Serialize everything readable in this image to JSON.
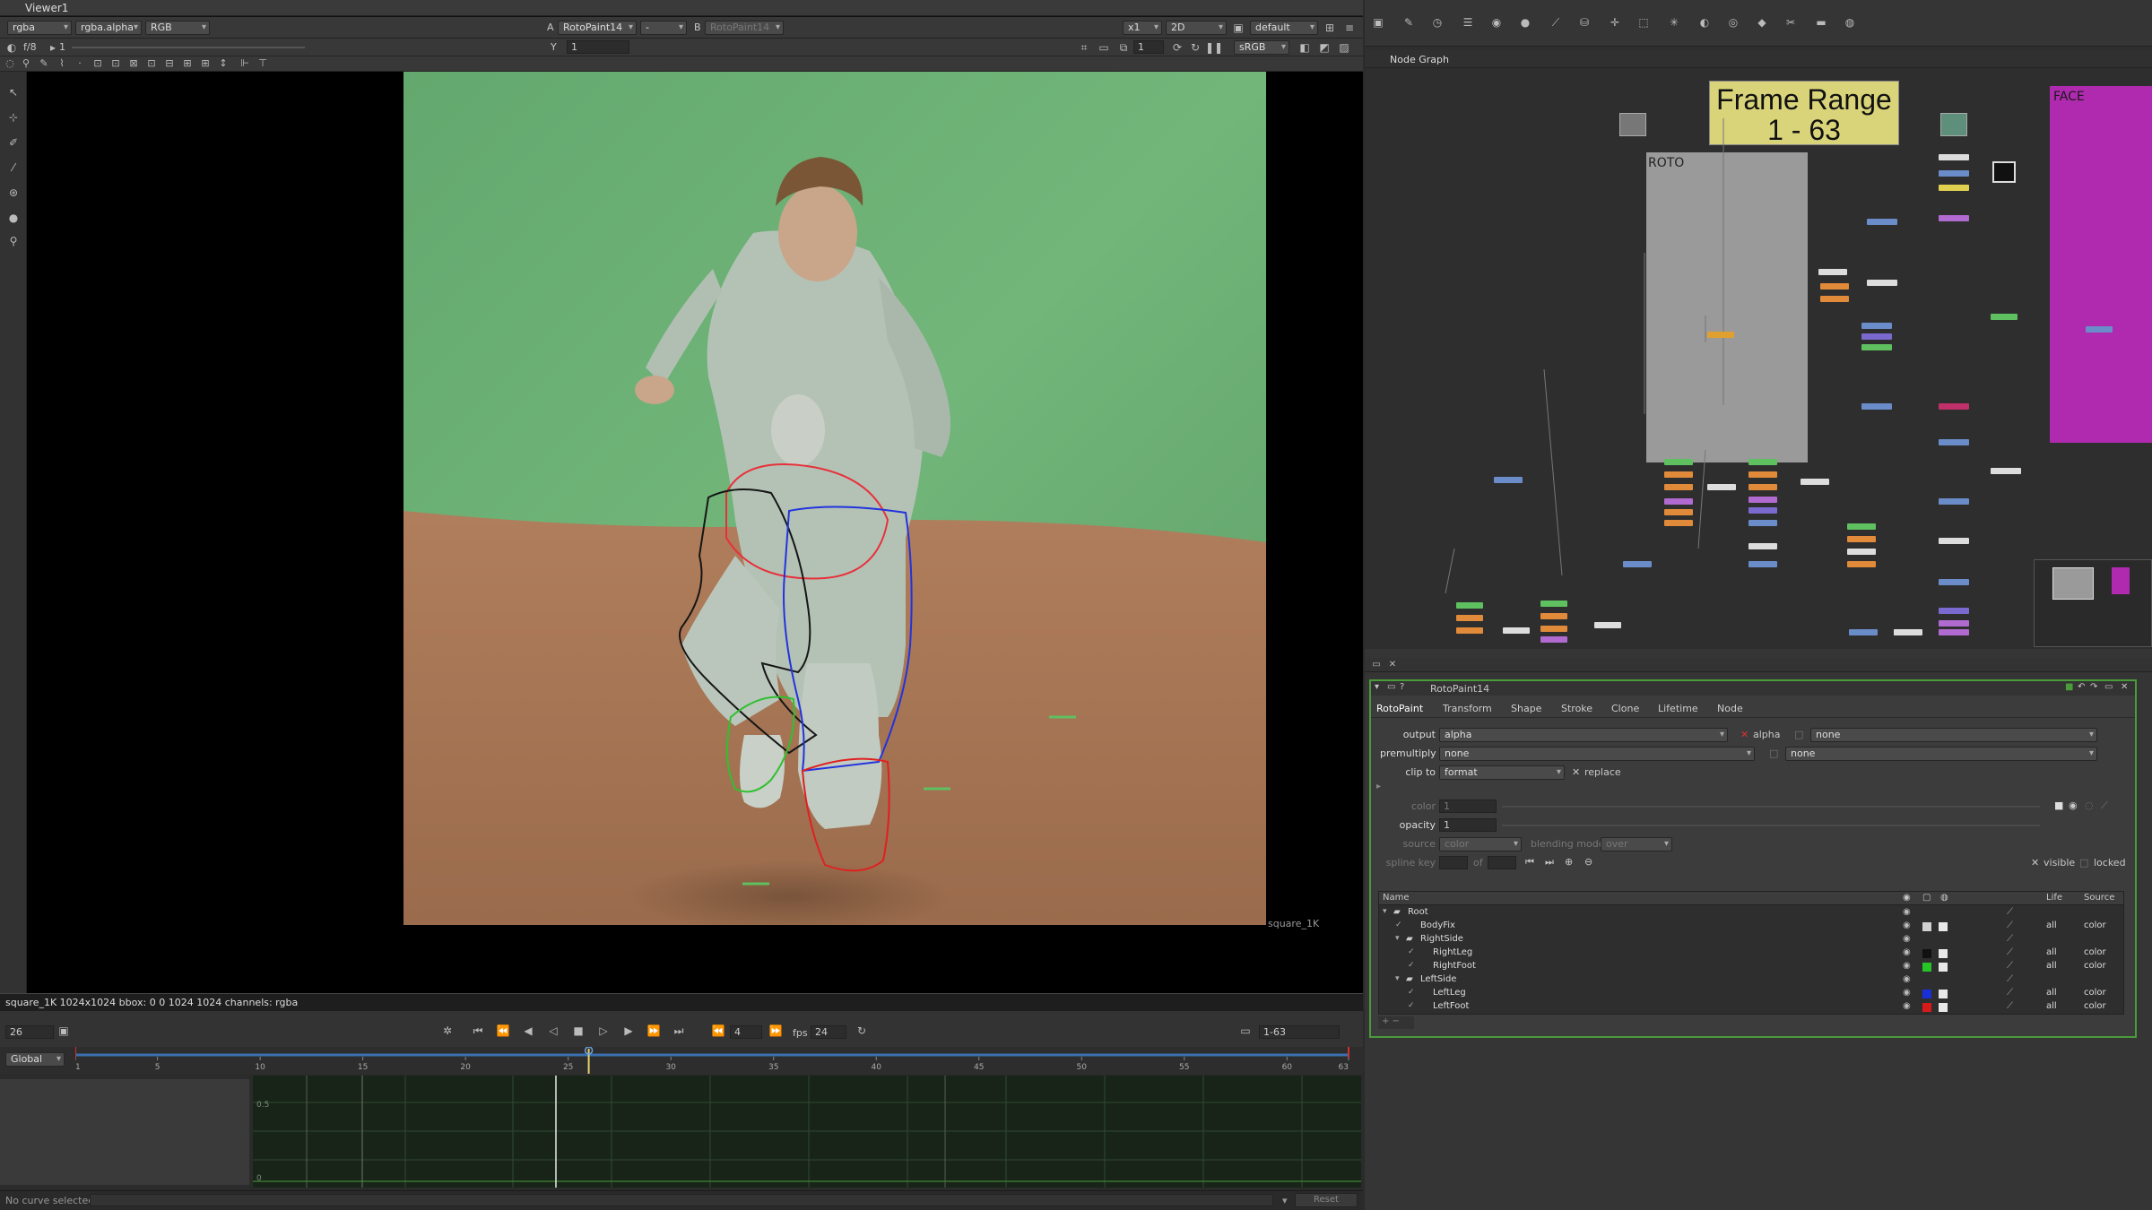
{
  "viewer": {
    "title": "Viewer1",
    "channels": "rgba",
    "alpha_channel": "rgba.alpha",
    "colorspace": "RGB",
    "input_a_label": "A",
    "input_a": "RotoPaint14",
    "input_a_op": "-",
    "input_b_label": "B",
    "input_b": "RotoPaint14",
    "zoom": "x1",
    "view_mode": "2D",
    "lut": "default",
    "display": "sRGB",
    "gain": "f/8",
    "gamma": "1",
    "y_label": "Y",
    "y_value": "1",
    "frame_field": "1",
    "format_label": "square_1K",
    "info_bar": "square_1K 1024x1024  bbox: 0 0 1024 1024  channels: rgba"
  },
  "transport": {
    "current_frame": "26",
    "fps_label": "fps",
    "fps": "24",
    "increment": "4",
    "range": "1-63",
    "mode": "Global"
  },
  "timeline": {
    "ticks": [
      "1",
      "5",
      "10",
      "15",
      "20",
      "25",
      "30",
      "35",
      "40",
      "45",
      "50",
      "55",
      "60",
      "63"
    ],
    "current_frame": 26,
    "first": 1,
    "last": 63
  },
  "curve_editor": {
    "y_tick": "0.5",
    "y_zero": "0",
    "status": "No curve selected",
    "reset_label": "Reset"
  },
  "node_graph": {
    "tab": "Node Graph",
    "sticky_note": {
      "line1": "Frame Range",
      "line2": "1 - 63",
      "color": "#d9d47a"
    },
    "backdrop_roto": {
      "label": "ROTO",
      "color": "#9a9a9a"
    },
    "backdrop_face": {
      "label": "FACE",
      "color": "#b02ab0"
    }
  },
  "properties": {
    "node_name": "RotoPaint14",
    "tabs": [
      "RotoPaint",
      "Transform",
      "Shape",
      "Stroke",
      "Clone",
      "Lifetime",
      "Node"
    ],
    "output_label": "output",
    "output_value": "alpha",
    "output_alpha": "alpha",
    "output_extra": "none",
    "premultiply_label": "premultiply",
    "premultiply_value": "none",
    "premultiply_extra": "none",
    "clip_to_label": "clip to",
    "clip_to_value": "format",
    "replace_label": "replace",
    "color_label": "color",
    "color_value": "1",
    "opacity_label": "opacity",
    "opacity_value": "1",
    "source_label": "source",
    "source_value": "color",
    "blending_label": "blending mode",
    "blending_value": "over",
    "spline_key_label": "spline key",
    "of_label": "of",
    "visible_label": "visible",
    "locked_label": "locked",
    "columns": {
      "name": "Name",
      "life": "Life",
      "source": "Source"
    },
    "layers": [
      {
        "name": "Root",
        "life": "",
        "source": "",
        "swatch": ""
      },
      {
        "name": "BodyFix",
        "life": "all",
        "source": "color",
        "swatch": "#d0d0d0"
      },
      {
        "name": "RightSide",
        "life": "",
        "source": "",
        "swatch": ""
      },
      {
        "name": "RightLeg",
        "life": "all",
        "source": "color",
        "swatch": "#111111"
      },
      {
        "name": "RightFoot",
        "life": "all",
        "source": "color",
        "swatch": "#27c427"
      },
      {
        "name": "LeftSide",
        "life": "",
        "source": "",
        "swatch": ""
      },
      {
        "name": "LeftLeg",
        "life": "all",
        "source": "color",
        "swatch": "#1a2fd8"
      },
      {
        "name": "LeftFoot",
        "life": "all",
        "source": "color",
        "swatch": "#d81a1a"
      }
    ]
  },
  "colors": {
    "accent_green": "#4a9b3a",
    "timeline_blue": "#3a6fb0",
    "playhead": "#e6d36a"
  }
}
